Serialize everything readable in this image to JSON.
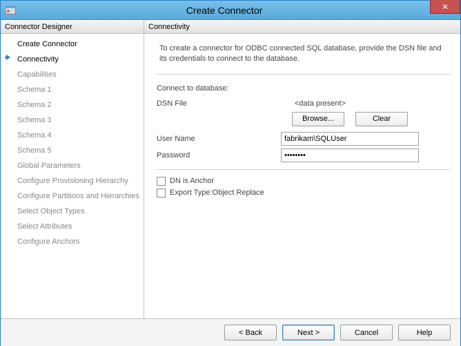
{
  "window": {
    "title": "Create Connector",
    "close_symbol": "✕"
  },
  "left": {
    "header": "Connector Designer",
    "items": [
      {
        "label": "Create Connector",
        "state": "completed"
      },
      {
        "label": "Connectivity",
        "state": "current"
      },
      {
        "label": "Capabilities",
        "state": "pending"
      },
      {
        "label": "Schema 1",
        "state": "pending"
      },
      {
        "label": "Schema 2",
        "state": "pending"
      },
      {
        "label": "Schema 3",
        "state": "pending"
      },
      {
        "label": "Schema 4",
        "state": "pending"
      },
      {
        "label": "Schema 5",
        "state": "pending"
      },
      {
        "label": "Global Parameters",
        "state": "pending"
      },
      {
        "label": "Configure Provisioning Hierarchy",
        "state": "pending"
      },
      {
        "label": "Configure Partitions and Hierarchies",
        "state": "pending"
      },
      {
        "label": "Select Object Types",
        "state": "pending"
      },
      {
        "label": "Select Attributes",
        "state": "pending"
      },
      {
        "label": "Configure Anchors",
        "state": "pending"
      }
    ]
  },
  "right": {
    "header": "Connectivity",
    "description": "To create a connector for ODBC connected SQL database, provide the DSN file and its credentials to connect to the database.",
    "section_label": "Connect to database:",
    "dsn_label": "DSN File",
    "dsn_value": "<data present>",
    "browse_label": "Browse...",
    "clear_label": "Clear",
    "user_label": "User Name",
    "user_value": "fabrikam\\SQLUser",
    "pass_label": "Password",
    "pass_value": "••••••••",
    "chk1_label": "DN is Anchor",
    "chk2_label": "Export Type:Object Replace"
  },
  "footer": {
    "back": "<  Back",
    "next": "Next  >",
    "cancel": "Cancel",
    "help": "Help"
  }
}
